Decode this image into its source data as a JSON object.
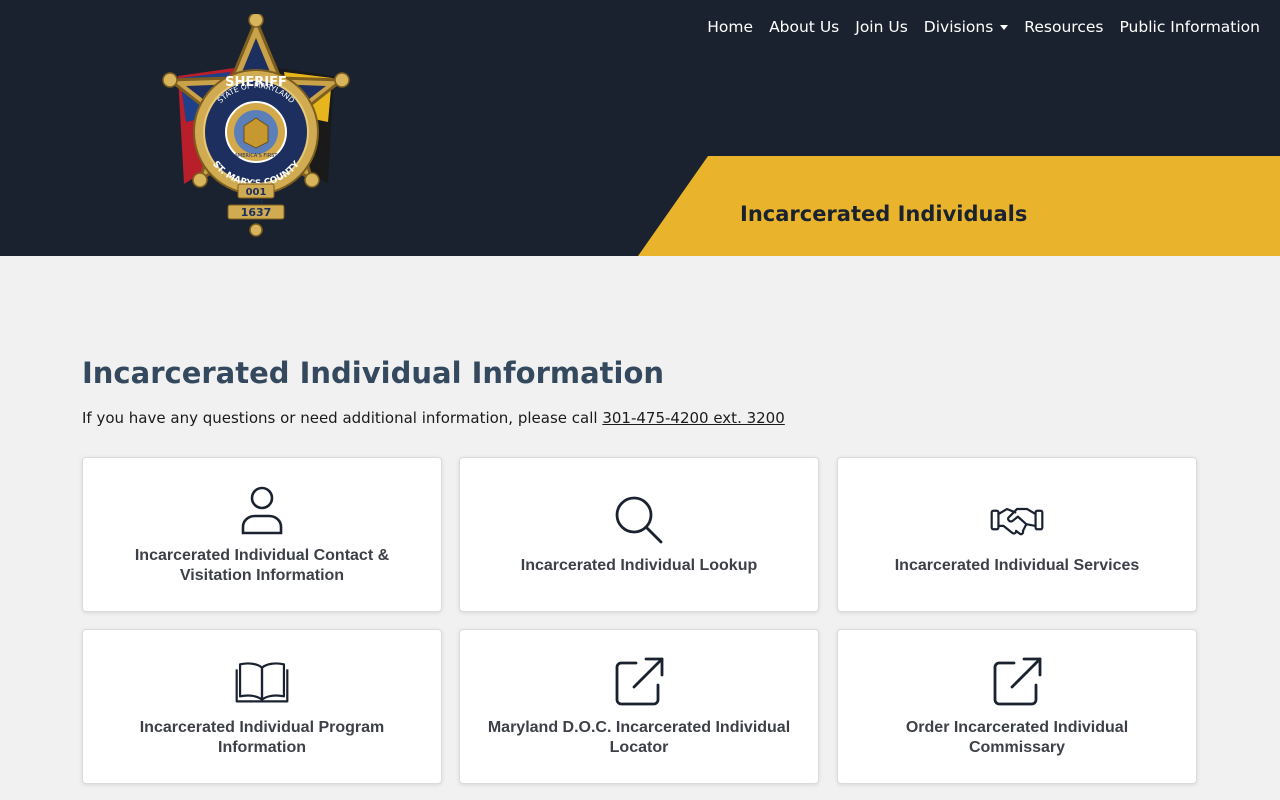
{
  "nav": {
    "items": [
      {
        "label": "Home"
      },
      {
        "label": "About Us"
      },
      {
        "label": "Join Us"
      },
      {
        "label": "Divisions",
        "dropdown": true
      },
      {
        "label": "Resources"
      },
      {
        "label": "Public Information"
      }
    ]
  },
  "header": {
    "badge": {
      "top_text": "SHERIFF",
      "ring_top": "STATE OF MARYLAND",
      "ring_bottom": "ST. MARY'S COUNTY",
      "motto": "AMERICA'S FIRST",
      "number": "001",
      "since_label": "SINCE",
      "year": "1637"
    },
    "banner_title": "Incarcerated Individuals"
  },
  "main": {
    "title": "Incarcerated Individual Information",
    "intro_text": "If you have any questions or need additional information, please call ",
    "phone": "301-475-4200 ext. 3200"
  },
  "cards": [
    {
      "label": "Incarcerated Individual Contact & Visitation Information",
      "icon": "person-icon"
    },
    {
      "label": "Incarcerated Individual Lookup",
      "icon": "search-icon"
    },
    {
      "label": "Incarcerated Individual Services",
      "icon": "handshake-icon"
    },
    {
      "label": "Incarcerated Individual Program Information",
      "icon": "book-icon"
    },
    {
      "label": "Maryland D.O.C. Incarcerated Individual Locator",
      "icon": "external-link-icon"
    },
    {
      "label": "Order Incarcerated Individual Commissary",
      "icon": "external-link-icon"
    }
  ],
  "colors": {
    "header_bg": "#1a2230",
    "banner_gold": "#e9b42b",
    "title_blue": "#34495e",
    "page_bg": "#f1f1f1"
  }
}
